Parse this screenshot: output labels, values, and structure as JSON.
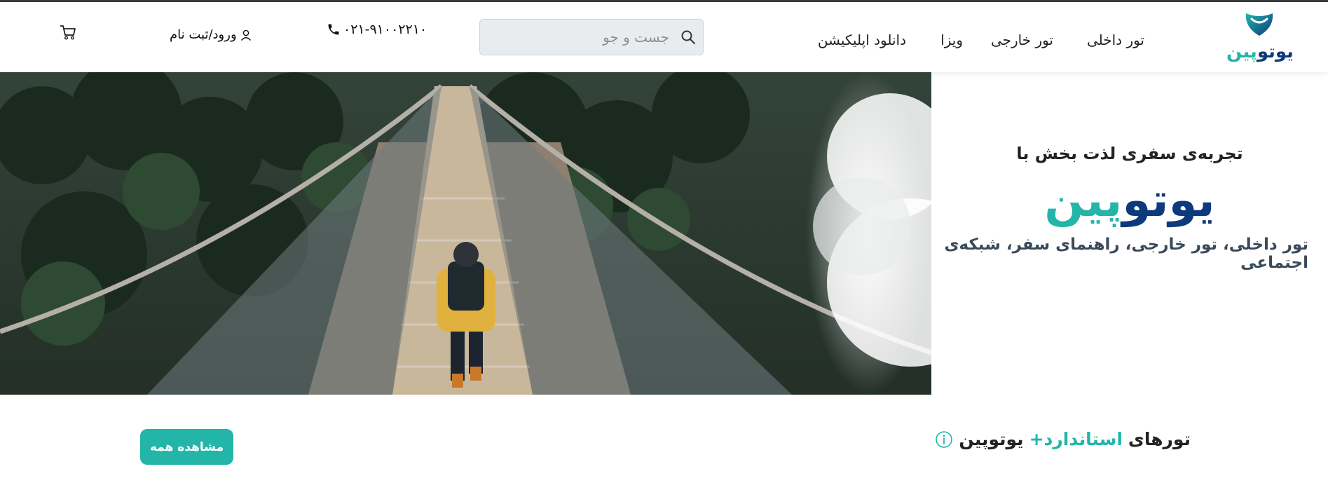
{
  "brand": {
    "part1": "یوتو",
    "part2": "پین"
  },
  "nav": {
    "domestic": "تور داخلی",
    "foreign": "تور خارجی",
    "visa": "ویزا",
    "app": "دانلود اپلیکیشن"
  },
  "search": {
    "placeholder": "جست و جو"
  },
  "phone": "۰۲۱-۹۱۰۰۲۲۱۰",
  "login": "ورود/ثبت نام",
  "hero": {
    "title": "تجربه‌ی سفری لذت بخش با",
    "subtitle": "تور داخلی، تور خارجی، راهنمای سفر، شبکه‌ی اجتماعی"
  },
  "section": {
    "title_prefix": "تورهای",
    "title_accent": "استاندارد+",
    "title_suffix": "یوتوپین",
    "view_all": "مشاهده همه"
  },
  "colors": {
    "brand_dark": "#0d3a7c",
    "brand_teal": "#22b5a8",
    "button": "#22b5a8"
  },
  "icons": [
    "logo-shield-icon",
    "search-icon",
    "phone-icon",
    "user-icon",
    "cart-icon",
    "info-icon"
  ]
}
